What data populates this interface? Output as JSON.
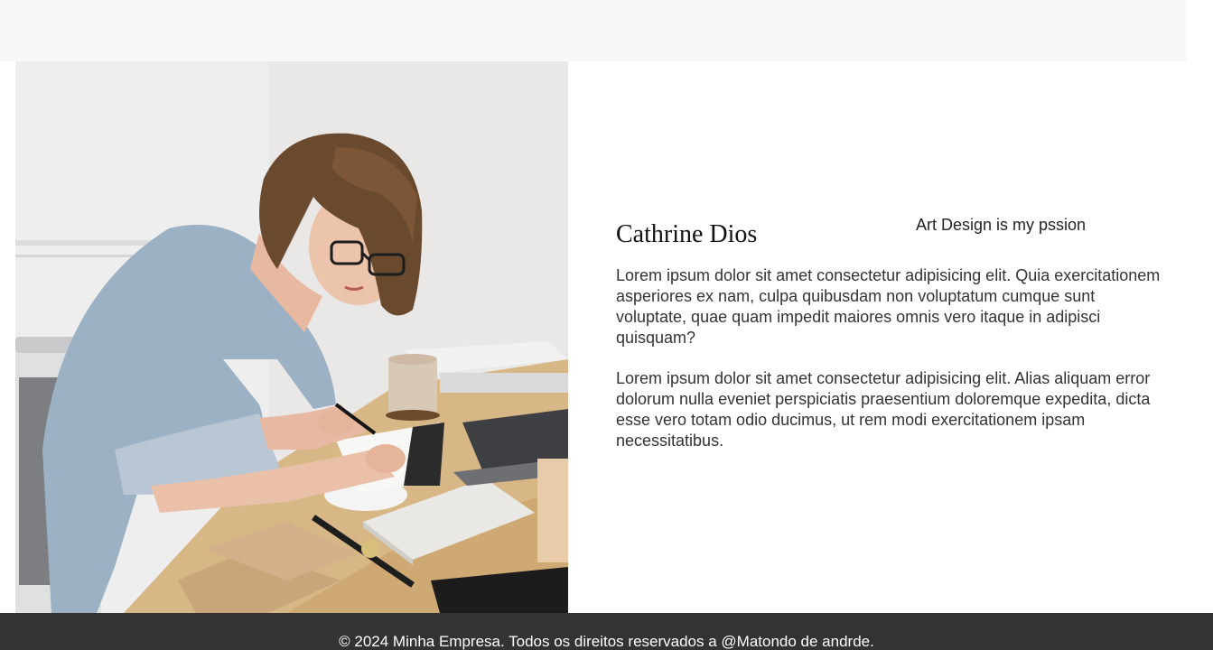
{
  "profile": {
    "name": "Cathrine Dios",
    "tagline": "Art Design is my pssion",
    "paragraphs": [
      "Lorem ipsum dolor sit amet consectetur adipisicing elit. Quia exercitationem asperiores ex nam, culpa quibusdam non voluptatum cumque sunt voluptate, quae quam impedit maiores omnis vero itaque in adipisci quisquam?",
      "Lorem ipsum dolor sit amet consectetur adipisicing elit. Alias aliquam error dolorum nulla eveniet perspiciatis praesentium doloremque expedita, dicta esse vero totam odio ducimus, ut rem modi exercitationem ipsam necessitatibus."
    ]
  },
  "footer": {
    "text": "© 2024 Minha Empresa. Todos os direitos reservados a @Matondo de andrde."
  },
  "colors": {
    "topbar": "#f8f8f8",
    "footer": "#333333",
    "text": "#333333"
  }
}
